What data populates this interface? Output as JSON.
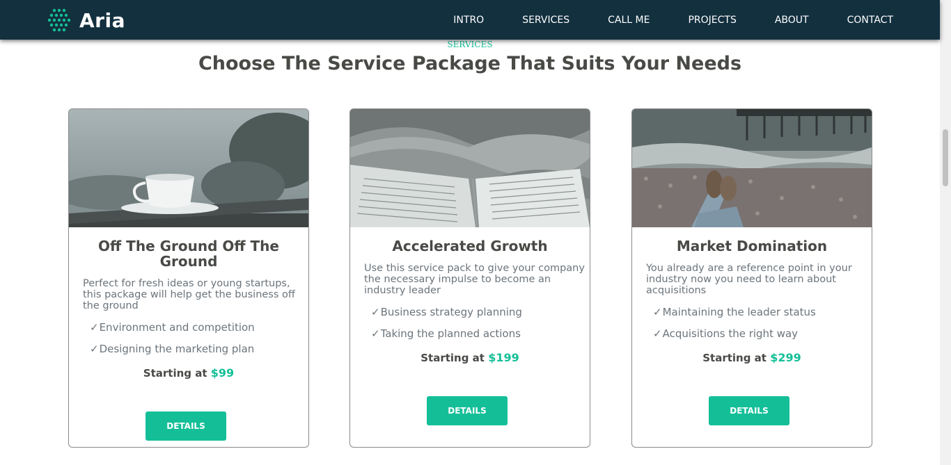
{
  "nav": {
    "brand": "Aria",
    "links": [
      "INTRO",
      "SERVICES",
      "CALL ME",
      "PROJECTS",
      "ABOUT",
      "CONTACT"
    ]
  },
  "section": {
    "label": "SERVICES",
    "title": "Choose The Service Package That Suits Your Needs"
  },
  "cards": [
    {
      "title": "Off The Ground Off The Ground",
      "description": "Perfect for fresh ideas or young startups, this package will help get the business off the ground",
      "features": [
        "Environment and competition",
        "Designing the marketing plan"
      ],
      "price_label": "Starting at",
      "price": "$99",
      "button": "DETAILS"
    },
    {
      "title": "Accelerated Growth",
      "description": "Use this service pack to give your company the necessary impulse to become an industry leader",
      "features": [
        "Business strategy planning",
        "Taking the planned actions"
      ],
      "price_label": "Starting at",
      "price": "$199",
      "button": "DETAILS"
    },
    {
      "title": "Market Domination",
      "description": "You already are a reference point in your industry now you need to learn about acquisitions",
      "features": [
        "Maintaining the leader status",
        "Acquisitions the right way"
      ],
      "price_label": "Starting at",
      "price": "$299",
      "button": "DETAILS"
    }
  ],
  "colors": {
    "navbar": "#13303f",
    "accent": "#14bf98",
    "heading": "#484a46",
    "body_text": "#6b747b"
  },
  "icons": {
    "logo": "dot-grid-logo-icon",
    "check": "checkmark-icon"
  }
}
